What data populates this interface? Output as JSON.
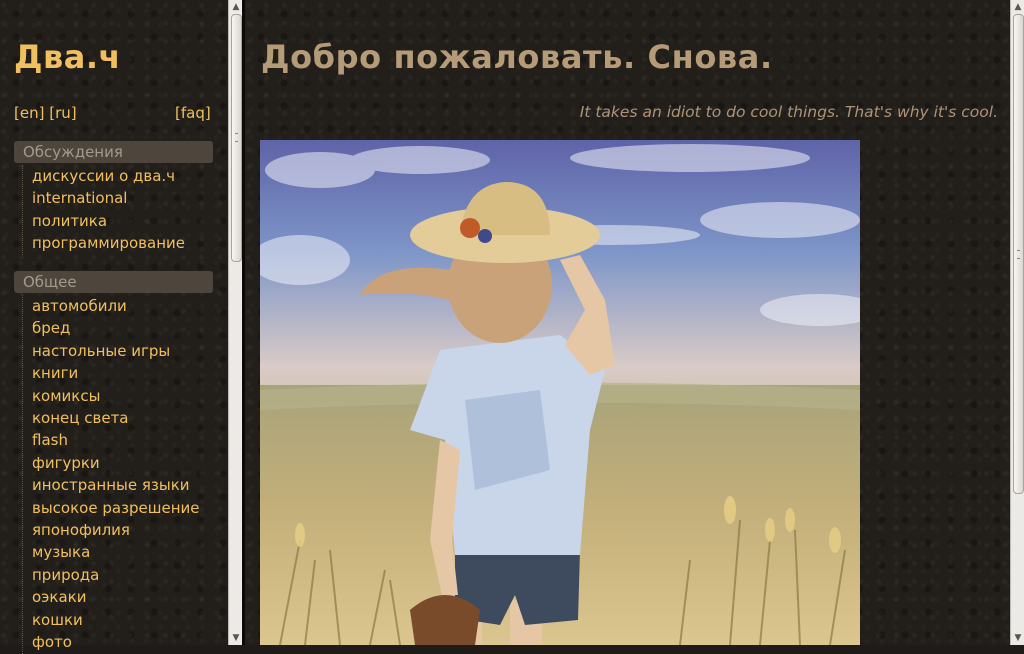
{
  "site": {
    "title": "Два.ч"
  },
  "lang": {
    "en": "[en]",
    "ru": "[ru]",
    "faq": "[faq]"
  },
  "sections": [
    {
      "title": "Обсуждения",
      "items": [
        "дискуссии о два.ч",
        "international",
        "политика",
        "программирование"
      ]
    },
    {
      "title": "Общее",
      "items": [
        "автомобили",
        "бред",
        "настольные игры",
        "книги",
        "комиксы",
        "конец света",
        "flash",
        "фигурки",
        "иностранные языки",
        "высокое разрешение",
        "японофилия",
        "музыка",
        "природа",
        "оэкаки",
        "кошки",
        "фото"
      ]
    }
  ],
  "main": {
    "heading": "Добро пожаловать. Снова.",
    "tagline": "It takes an idiot to do cool things. That's why it's cool."
  },
  "colors": {
    "accent": "#f0c060",
    "heading": "#b69b78",
    "background": "#221e1a"
  }
}
